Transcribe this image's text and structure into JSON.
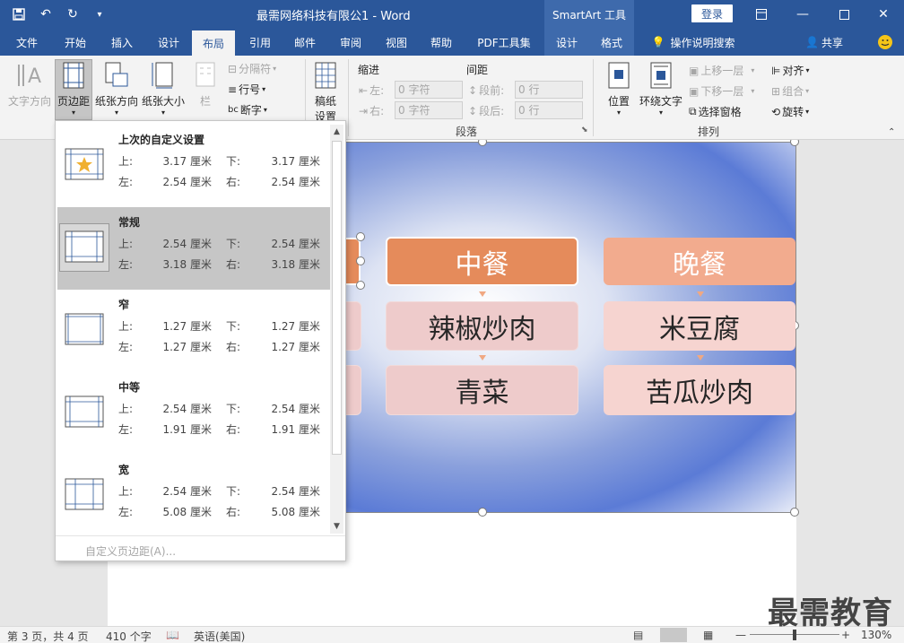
{
  "titlebar": {
    "title": "最需网络科技有限公1  -  Word",
    "context_tool": "SmartArt 工具",
    "login": "登录",
    "icons": [
      "save-icon",
      "undo-icon",
      "redo-icon",
      "customize-icon",
      "ribbon-display-icon",
      "minimize-icon",
      "maximize-icon",
      "close-icon"
    ]
  },
  "tabs": [
    {
      "label": "文件",
      "active": false
    },
    {
      "label": "开始",
      "active": false
    },
    {
      "label": "插入",
      "active": false
    },
    {
      "label": "设计",
      "active": false
    },
    {
      "label": "布局",
      "active": true
    },
    {
      "label": "引用",
      "active": false
    },
    {
      "label": "邮件",
      "active": false
    },
    {
      "label": "审阅",
      "active": false
    },
    {
      "label": "视图",
      "active": false
    },
    {
      "label": "帮助",
      "active": false
    },
    {
      "label": "PDF工具集",
      "active": false
    },
    {
      "label": "设计",
      "active": false
    },
    {
      "label": "格式",
      "active": false
    }
  ],
  "tell_me": "操作说明搜索",
  "share": "共享",
  "ribbon": {
    "text_direction": "文字方向",
    "margins": "页边距",
    "orientation": "纸张方向",
    "size": "纸张大小",
    "columns": "栏",
    "breaks": "分隔符",
    "line_numbers": "行号",
    "hyphenation": "断字",
    "draft_paper": "稿纸\n设置",
    "draft_paper_l1": "稿纸",
    "draft_paper_l2": "设置",
    "indent": "缩进",
    "spacing": "间距",
    "indent_left": "左:",
    "indent_right": "右:",
    "indent_left_val": "0 字符",
    "indent_right_val": "0 字符",
    "spacing_before": "段前:",
    "spacing_after": "段后:",
    "spacing_before_val": "0 行",
    "spacing_after_val": "0 行",
    "paragraph_group": "段落",
    "position": "位置",
    "wrap_text": "环绕文字",
    "bring_forward": "上移一层",
    "send_backward": "下移一层",
    "selection_pane": "选择窗格",
    "align": "对齐",
    "group": "组合",
    "rotate": "旋转",
    "arrange_group": "排列"
  },
  "margins_gallery": {
    "entries": [
      {
        "title": "上次的自定义设置",
        "top_label": "上:",
        "top": "3.17 厘米",
        "bottom_label": "下:",
        "bottom": "3.17 厘米",
        "left_label": "左:",
        "left": "2.54 厘米",
        "right_label": "右:",
        "right": "2.54 厘米",
        "selected": false,
        "icon": "star-margin-icon"
      },
      {
        "title": "常规",
        "top_label": "上:",
        "top": "2.54 厘米",
        "bottom_label": "下:",
        "bottom": "2.54 厘米",
        "left_label": "左:",
        "left": "3.18 厘米",
        "right_label": "右:",
        "right": "3.18 厘米",
        "selected": true,
        "icon": "normal-margin-icon"
      },
      {
        "title": "窄",
        "top_label": "上:",
        "top": "1.27 厘米",
        "bottom_label": "下:",
        "bottom": "1.27 厘米",
        "left_label": "左:",
        "left": "1.27 厘米",
        "right_label": "右:",
        "right": "1.27 厘米",
        "selected": false,
        "icon": "narrow-margin-icon"
      },
      {
        "title": "中等",
        "top_label": "上:",
        "top": "2.54 厘米",
        "bottom_label": "下:",
        "bottom": "2.54 厘米",
        "left_label": "左:",
        "left": "1.91 厘米",
        "right_label": "右:",
        "right": "1.91 厘米",
        "selected": false,
        "icon": "moderate-margin-icon"
      },
      {
        "title": "宽",
        "top_label": "上:",
        "top": "2.54 厘米",
        "bottom_label": "下:",
        "bottom": "2.54 厘米",
        "left_label": "左:",
        "left": "5.08 厘米",
        "right_label": "右:",
        "right": "5.08 厘米",
        "selected": false,
        "icon": "wide-margin-icon"
      }
    ],
    "custom": "自定义页边距(A)..."
  },
  "smartart": {
    "headers": [
      "中餐",
      "晚餐"
    ],
    "items": [
      [
        "辣椒炒肉",
        "青菜"
      ],
      [
        "米豆腐",
        "苦瓜炒肉"
      ]
    ]
  },
  "status": {
    "page": "第 3 页，共 4 页",
    "words": "410 个字",
    "language": "英语(美国)",
    "zoom": "130%"
  },
  "watermark": "最需教育",
  "colors": {
    "brand": "#2b579a",
    "context": "#3e6aac",
    "header_box": "#e58b5b",
    "item_box": "#eecbcb"
  }
}
